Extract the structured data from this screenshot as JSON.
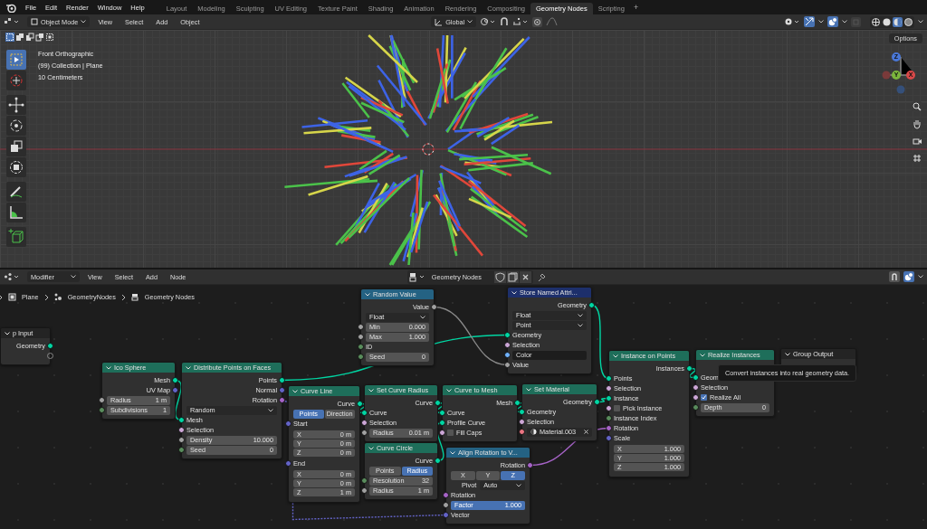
{
  "menu": [
    "File",
    "Edit",
    "Render",
    "Window",
    "Help"
  ],
  "workspace_tabs": [
    {
      "label": "Layout",
      "selected": false
    },
    {
      "label": "Modeling",
      "selected": false
    },
    {
      "label": "Sculpting",
      "selected": false
    },
    {
      "label": "UV Editing",
      "selected": false
    },
    {
      "label": "Texture Paint",
      "selected": false
    },
    {
      "label": "Shading",
      "selected": false
    },
    {
      "label": "Animation",
      "selected": false
    },
    {
      "label": "Rendering",
      "selected": false
    },
    {
      "label": "Compositing",
      "selected": false
    },
    {
      "label": "Geometry Nodes",
      "selected": true
    },
    {
      "label": "Scripting",
      "selected": false
    }
  ],
  "add_tab": "+",
  "viewport": {
    "header": {
      "mode": "Object Mode",
      "menus": [
        "View",
        "Select",
        "Add",
        "Object"
      ],
      "orientation": "Global",
      "shading": [
        {
          "kind": "wireframe",
          "selected": false
        },
        {
          "kind": "solid",
          "selected": false
        },
        {
          "kind": "material",
          "selected": true
        },
        {
          "kind": "rendered",
          "selected": false
        }
      ]
    },
    "selection_modes": [
      {
        "kind": "new",
        "selected": true
      },
      {
        "kind": "extend",
        "selected": false
      },
      {
        "kind": "subtract",
        "selected": false
      },
      {
        "kind": "invert",
        "selected": false
      },
      {
        "kind": "intersect",
        "selected": false
      }
    ],
    "tool_groups": [
      [
        {
          "kind": "select",
          "selected": true
        },
        {
          "kind": "cursor",
          "selected": false
        }
      ],
      [
        {
          "kind": "move",
          "selected": false
        },
        {
          "kind": "rotate",
          "selected": false
        },
        {
          "kind": "scale",
          "selected": false
        },
        {
          "kind": "transform",
          "selected": false
        }
      ],
      [
        {
          "kind": "annotate",
          "selected": false
        },
        {
          "kind": "measure",
          "selected": false
        }
      ],
      [
        {
          "kind": "add_cube",
          "selected": false
        }
      ]
    ],
    "overlay_text": [
      "Front Orthographic",
      "(99) Collection | Plane",
      "10 Centimeters"
    ],
    "options": "Options",
    "gizmo_axes": [
      "Z",
      "Y",
      "X"
    ]
  },
  "node_editor": {
    "header": {
      "context": "Modifier",
      "menus": [
        "View",
        "Select",
        "Add",
        "Node"
      ],
      "node_group": "Geometry Nodes"
    },
    "breadcrumbs": [
      "Plane",
      "GeometryNodes",
      "Geometry Nodes"
    ],
    "nodes": [
      {
        "title": "p Input",
        "color": "#242424",
        "rows": [
          {
            "kind": "output",
            "label": "Geometry",
            "color": "#00d6a3"
          },
          {
            "kind": "hollow_output"
          }
        ]
      },
      {
        "title": "Ico Sphere",
        "color": "#1e6e5a",
        "rows": [
          {
            "kind": "output",
            "label": "Mesh",
            "color": "#00d6a3"
          },
          {
            "kind": "output",
            "label": "UV Map",
            "color": "#6363c7"
          },
          {
            "kind": "value",
            "label": "Radius",
            "value": "1 m",
            "color": "#a1a1a1"
          },
          {
            "kind": "value",
            "label": "Subdivisions",
            "value": "1",
            "color": "#598c5c"
          }
        ]
      },
      {
        "title": "Distribute Points on Faces",
        "color": "#1e6e5a",
        "rows": [
          {
            "kind": "output",
            "label": "Points",
            "color": "#00d6a3"
          },
          {
            "kind": "output",
            "label": "Normal",
            "color": "#6363c7"
          },
          {
            "kind": "output",
            "label": "Rotation",
            "color": "#a663c7"
          },
          {
            "kind": "dropdown",
            "value": "Random"
          },
          {
            "kind": "input",
            "label": "Mesh",
            "color": "#00d6a3"
          },
          {
            "kind": "input",
            "label": "Selection",
            "color": "#cca6d6"
          },
          {
            "kind": "value",
            "label": "Density",
            "value": "10.000",
            "color": "#a1a1a1"
          },
          {
            "kind": "value",
            "label": "Seed",
            "value": "0",
            "color": "#598c5c"
          }
        ]
      },
      {
        "title": "Random Value",
        "color": "#246283",
        "rows": [
          {
            "kind": "output",
            "label": "Value",
            "color": "#a1a1a1"
          },
          {
            "kind": "dropdown",
            "value": "Float"
          },
          {
            "kind": "value",
            "label": "Min",
            "value": "0.000",
            "color": "#a1a1a1"
          },
          {
            "kind": "value",
            "label": "Max",
            "value": "1.000",
            "color": "#a1a1a1"
          },
          {
            "kind": "input",
            "label": "ID",
            "color": "#598c5c"
          },
          {
            "kind": "value",
            "label": "Seed",
            "value": "0",
            "color": "#598c5c"
          }
        ]
      },
      {
        "title": "Store Named Attri...",
        "color": "#1d2f6b",
        "rows": [
          {
            "kind": "output",
            "label": "Geometry",
            "color": "#00d6a3"
          },
          {
            "kind": "dropdown",
            "value": "Float"
          },
          {
            "kind": "dropdown",
            "value": "Point"
          },
          {
            "kind": "input",
            "label": "Geometry",
            "color": "#00d6a3"
          },
          {
            "kind": "input",
            "label": "Selection",
            "color": "#cca6d6"
          },
          {
            "kind": "text_field",
            "value": "Color",
            "color": "#70b2ff"
          },
          {
            "kind": "input",
            "label": "Value",
            "color": "#a1a1a1"
          }
        ]
      },
      {
        "title": "Curve Line",
        "color": "#1e6e5a",
        "rows": [
          {
            "kind": "output",
            "label": "Curve",
            "color": "#00d6a3"
          },
          {
            "kind": "toggle",
            "options": [
              {
                "label": "Points",
                "selected": true
              },
              {
                "label": "Direction",
                "selected": false
              }
            ]
          },
          {
            "kind": "input",
            "label": "Start",
            "color": "#6363c7"
          },
          {
            "kind": "vector",
            "items": [
              {
                "label": "X",
                "value": "0 m"
              },
              {
                "label": "Y",
                "value": "0 m"
              },
              {
                "label": "Z",
                "value": "0 m"
              }
            ]
          },
          {
            "kind": "input",
            "label": "End",
            "color": "#6363c7"
          },
          {
            "kind": "vector",
            "items": [
              {
                "label": "X",
                "value": "0 m"
              },
              {
                "label": "Y",
                "value": "0 m"
              },
              {
                "label": "Z",
                "value": "1 m"
              }
            ]
          }
        ]
      },
      {
        "title": "Set Curve Radius",
        "color": "#1e6e5a",
        "rows": [
          {
            "kind": "output",
            "label": "Curve",
            "color": "#00d6a3"
          },
          {
            "kind": "input",
            "label": "Curve",
            "color": "#00d6a3"
          },
          {
            "kind": "input",
            "label": "Selection",
            "color": "#cca6d6"
          },
          {
            "kind": "value",
            "label": "Radius",
            "value": "0.01 m",
            "color": "#a1a1a1"
          }
        ]
      },
      {
        "title": "Curve Circle",
        "color": "#1e6e5a",
        "rows": [
          {
            "kind": "output",
            "label": "Curve",
            "color": "#00d6a3"
          },
          {
            "kind": "toggle",
            "options": [
              {
                "label": "Points",
                "selected": false
              },
              {
                "label": "Radius",
                "selected": true
              }
            ]
          },
          {
            "kind": "value",
            "label": "Resolution",
            "value": "32",
            "color": "#598c5c"
          },
          {
            "kind": "value",
            "label": "Radius",
            "value": "1 m",
            "color": "#a1a1a1"
          }
        ]
      },
      {
        "title": "Curve to Mesh",
        "color": "#1e6e5a",
        "rows": [
          {
            "kind": "output",
            "label": "Mesh",
            "color": "#00d6a3"
          },
          {
            "kind": "input",
            "label": "Curve",
            "color": "#00d6a3"
          },
          {
            "kind": "input",
            "label": "Profile Curve",
            "color": "#00d6a3"
          },
          {
            "kind": "checkbox",
            "label": "Fill Caps",
            "checked": false,
            "color": "#cca6d6"
          }
        ]
      },
      {
        "title": "Set Material",
        "color": "#1e6e5a",
        "rows": [
          {
            "kind": "output",
            "label": "Geometry",
            "color": "#00d6a3"
          },
          {
            "kind": "input",
            "label": "Geometry",
            "color": "#00d6a3"
          },
          {
            "kind": "input",
            "label": "Selection",
            "color": "#cca6d6"
          },
          {
            "kind": "material",
            "value": "Material.003",
            "color": "#eb7582"
          }
        ]
      },
      {
        "title": "Align Rotation to V...",
        "color": "#246283",
        "rows": [
          {
            "kind": "output",
            "label": "Rotation",
            "color": "#a663c7"
          },
          {
            "kind": "toggle",
            "options": [
              {
                "label": "X",
                "selected": false
              },
              {
                "label": "Y",
                "selected": false
              },
              {
                "label": "Z",
                "selected": true
              }
            ]
          },
          {
            "kind": "labeled_dropdown",
            "label": "Pivot",
            "value": "Auto"
          },
          {
            "kind": "input",
            "label": "Rotation",
            "color": "#a663c7"
          },
          {
            "kind": "slider",
            "label": "Factor",
            "value": "1.000",
            "level": 1,
            "color": "#a1a1a1"
          },
          {
            "kind": "input",
            "label": "Vector",
            "color": "#6363c7"
          }
        ]
      },
      {
        "title": "Instance on Points",
        "color": "#1e6e5a",
        "rows": [
          {
            "kind": "output",
            "label": "Instances",
            "color": "#00d6a3"
          },
          {
            "kind": "input",
            "label": "Points",
            "color": "#00d6a3"
          },
          {
            "kind": "input",
            "label": "Selection",
            "color": "#cca6d6"
          },
          {
            "kind": "input",
            "label": "Instance",
            "color": "#00d6a3"
          },
          {
            "kind": "checkbox",
            "label": "Pick Instance",
            "checked": false,
            "color": "#cca6d6"
          },
          {
            "kind": "input",
            "label": "Instance Index",
            "color": "#598c5c"
          },
          {
            "kind": "input",
            "label": "Rotation",
            "color": "#a663c7"
          },
          {
            "kind": "input",
            "label": "Scale",
            "color": "#6363c7"
          },
          {
            "kind": "vector",
            "items": [
              {
                "label": "X",
                "value": "1.000"
              },
              {
                "label": "Y",
                "value": "1.000"
              },
              {
                "label": "Z",
                "value": "1.000"
              }
            ]
          }
        ]
      },
      {
        "title": "Realize Instances",
        "color": "#1e6e5a",
        "rows": [
          {
            "kind": "input",
            "label": "Geom",
            "color": "#00d6a3"
          },
          {
            "kind": "input",
            "label": "Selection",
            "color": "#cca6d6"
          },
          {
            "kind": "checkbox",
            "label": "Realize All",
            "checked": true,
            "color": "#cca6d6"
          },
          {
            "kind": "value",
            "label": "Depth",
            "value": "0",
            "color": "#598c5c"
          }
        ]
      },
      {
        "title": "Group Output",
        "color": "#242424"
      }
    ],
    "tooltip": "Convert instances into real geometry data."
  }
}
